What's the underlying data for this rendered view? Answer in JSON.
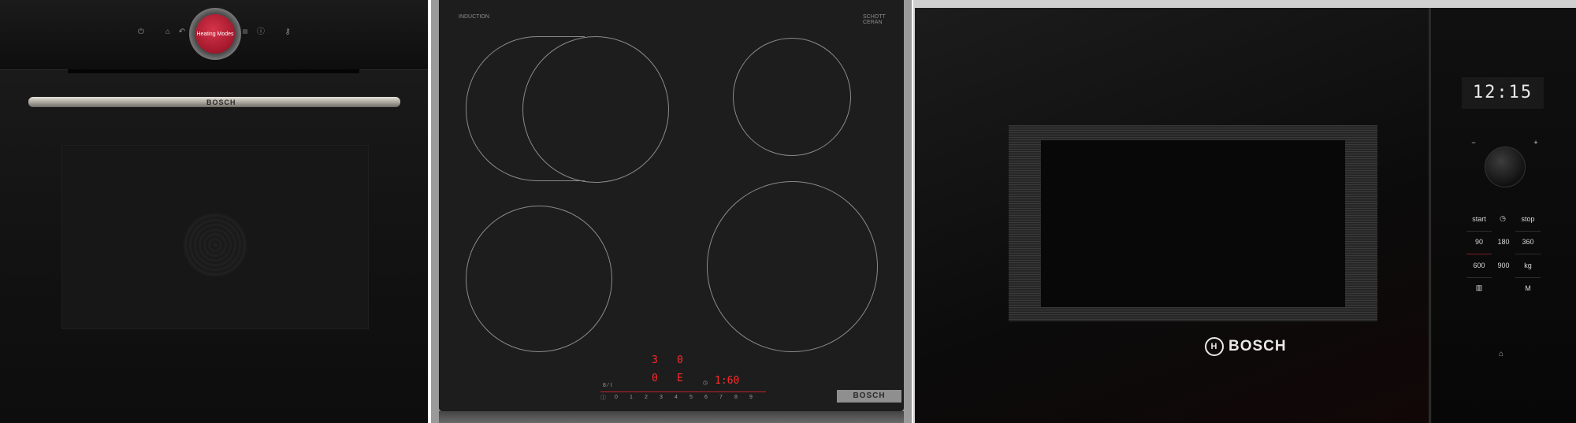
{
  "oven": {
    "knob_label": "Heating Modes",
    "icons": [
      "power-icon",
      "home-icon",
      "back-icon",
      "menu-icon",
      "info-icon",
      "key-icon"
    ],
    "brand": "BOSCH",
    "colors": {
      "knob": "#c21f35",
      "handle": "#c9c5bc"
    }
  },
  "hob": {
    "label_left": "INDUCTION",
    "label_right": "SCHOTT CERAN",
    "display_1": "3",
    "display_2": "0",
    "display_3": "0",
    "display_4": "E",
    "display_timer": "1:60",
    "scale": [
      "0",
      "1",
      "2",
      "3",
      "4",
      "5",
      "6",
      "7",
      "8",
      "9"
    ],
    "brand": "BOSCH",
    "colors": {
      "display": "#ff2a2a"
    }
  },
  "microwave": {
    "clock": "12:15",
    "brand": "BOSCH",
    "buttons": {
      "start": "start",
      "stop": "stop",
      "p90": "90",
      "p180": "180",
      "p360": "360",
      "p600": "600",
      "p900": "900",
      "kg": "kg",
      "memory": "M"
    },
    "knob_minus": "−",
    "knob_plus": "+"
  }
}
